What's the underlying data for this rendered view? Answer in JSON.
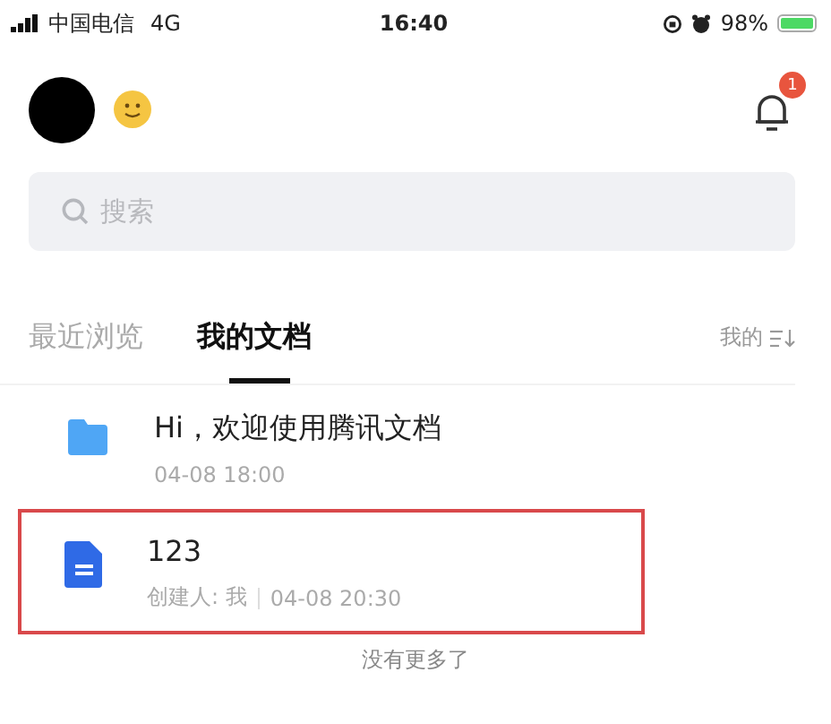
{
  "status_bar": {
    "carrier": "中国电信",
    "network": "4G",
    "time": "16:40",
    "battery": "98%"
  },
  "header": {
    "notifications": "1"
  },
  "search": {
    "placeholder": "搜索"
  },
  "tabs": [
    {
      "label": "最近浏览",
      "selected": false
    },
    {
      "label": "我的文档",
      "selected": true
    }
  ],
  "filter": {
    "label": "我的"
  },
  "documents": [
    {
      "kind": "folder",
      "title": "Hi，欢迎使用腾讯文档",
      "time": "04-08 18:00",
      "highlighted": false
    },
    {
      "kind": "doc",
      "title": "123",
      "creator": "创建人: 我",
      "time": "04-08 20:30",
      "highlighted": true
    }
  ],
  "footer": "没有更多了"
}
